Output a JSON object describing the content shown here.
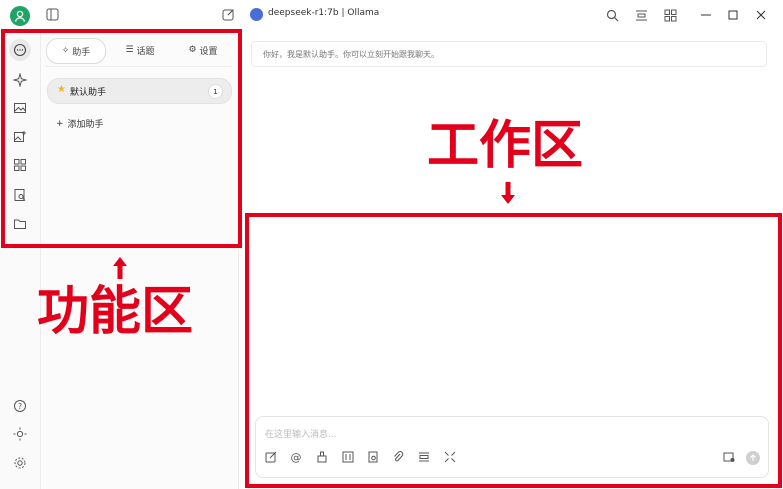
{
  "window": {
    "model_title": "deepseek-r1:7b | Ollama"
  },
  "panel": {
    "tabs": [
      {
        "label": "助手",
        "icon": "sparkle-icon"
      },
      {
        "label": "话题",
        "icon": "list-icon"
      },
      {
        "label": "设置",
        "icon": "gear-icon"
      }
    ],
    "assistant": {
      "label": "默认助手",
      "count": "1"
    },
    "add_assistant": "添加助手"
  },
  "main": {
    "greeting": "你好，我是默认助手。你可以立刻开始跟我聊天。",
    "input_placeholder": "在这里输入消息..."
  },
  "annotations": {
    "function_area": "功能区",
    "work_area": "工作区",
    "color": "#e3001b"
  }
}
